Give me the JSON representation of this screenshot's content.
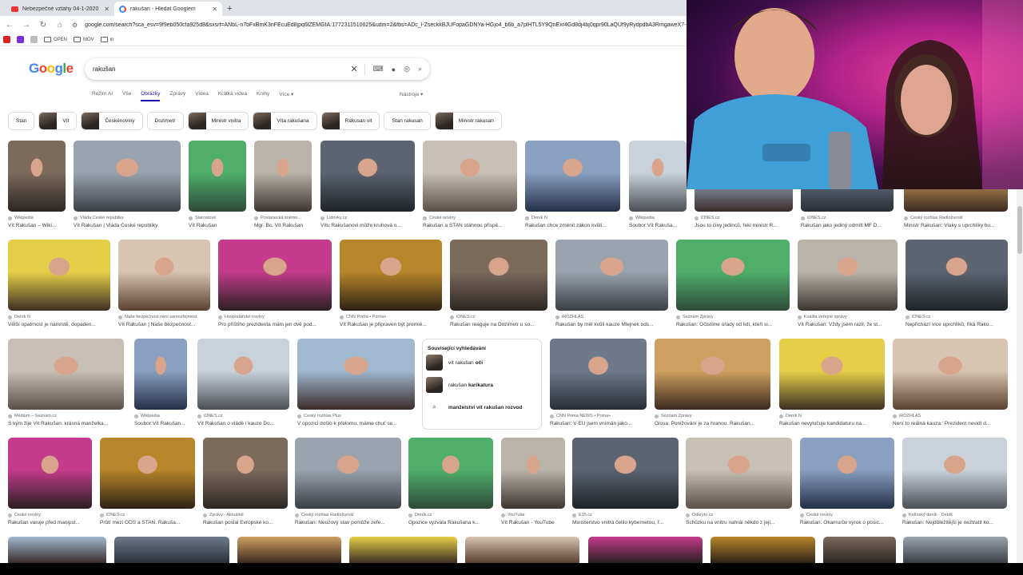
{
  "browser": {
    "tabs": [
      {
        "title": "Nebezpečné vztahy 04-1-2020",
        "active": false,
        "favicon": "youtube-icon"
      },
      {
        "title": "rakušan - Hledat Googlem",
        "active": true,
        "favicon": "google-icon"
      }
    ],
    "url": "google.com/search?sca_esv=9f9eb050cfa925d8&sxsrf=ANbL-n7bFxBmK3nFEcuEd8jpq6lZEMGfA:1772311510025&udm=2&fbs=ADc_l-ZseckkBJUFopaGDNYa-HGjo4_b6b_a7plHTL5Y9QnExr4Gd8dj4bj0qpr90LaQUf9yRydpdbA3RmgaweX7-8uxjZSty",
    "bookmarks": [
      "OPEN",
      "MOV",
      "in"
    ]
  },
  "search": {
    "query": "rakušan",
    "tabs": [
      "Režim AI",
      "Vše",
      "Obrázky",
      "Zprávy",
      "Videa",
      "Krátká videa",
      "Knihy",
      "Více ▾"
    ],
    "active_tab": "Obrázky",
    "tools": "Nástroje ▾"
  },
  "chips": [
    "Stan",
    "Vít",
    "Českénoviny",
    "Dozimetr",
    "Ministr vnitra",
    "Víta rakušana",
    "Rakusan vit",
    "Stan rakusan",
    "Ministr rakusan"
  ],
  "rows": [
    [
      {
        "src": "Wikipedia",
        "cap": "Vít Rakušan – Wiki..."
      },
      {
        "src": "Vláda České republiky",
        "cap": "Vít Rakušan | Vláda České republiky"
      },
      {
        "src": "Starostové",
        "cap": "Vít Rakušan"
      },
      {
        "src": "Poslanecká sněmo...",
        "cap": "Mgr. Bc. Vít Rakušan"
      },
      {
        "src": "Lidovky.cz",
        "cap": "Vítu Rakušanovi může kruhová o..."
      },
      {
        "src": "České noviny",
        "cap": "Rakušan a STAN stáhnou přispě..."
      },
      {
        "src": "Deník N",
        "cap": "Rakušan chce změnit zákon kvůli..."
      },
      {
        "src": "Wikipedia",
        "cap": "Soubor:Vít Rakuša..."
      },
      {
        "src": "iDNES.cz",
        "cap": "Jsou to činy jedinců, řekl ministr R..."
      },
      {
        "src": "iDNES.cz",
        "cap": "Rakušan jako jediný odmítl MF D..."
      },
      {
        "src": "Český rozhlas Radiožurnál",
        "cap": "Ministr Rakušan: Vlaky s uprchlíky bu..."
      }
    ],
    [
      {
        "src": "Deník N",
        "cap": "Větší opatrnost je namístě, dopaden..."
      },
      {
        "src": "Naše bezpečnost není samozřejmost",
        "cap": "Vít Rakušan | Naše bezpečnost..."
      },
      {
        "src": "Hospodářské noviny",
        "cap": "Pro příštího prezidenta mám jen dvě pod..."
      },
      {
        "src": "CNN Prima • Prima+",
        "cap": "Vít Rakušan je připraven být premié..."
      },
      {
        "src": "iDNES.cz",
        "cap": "Rakušan reaguje na Dozimetr u so..."
      },
      {
        "src": "iROZHLAS",
        "cap": "Rakušan by měl kvůli kauze Mlejnek ods..."
      },
      {
        "src": "Seznam Zprávy",
        "cap": "Rakušan: Očistíme úřady od lidí, kteří si..."
      },
      {
        "src": "Kvalita veřejné správy",
        "cap": "Vít Rakušan: Vždy jsem razil, že st..."
      },
      {
        "src": "iDNES.cz",
        "cap": "Nepřichází více uprchlíků, říká Raku..."
      }
    ],
    [
      {
        "src": "Médium – Seznam.cz",
        "cap": "S kým žije Vít Rakušan: krásná manželka..."
      },
      {
        "src": "Wikipedia",
        "cap": "Soubor:Vít Rakušan..."
      },
      {
        "src": "iDNES.cz",
        "cap": "Vít Rakušan o vládě i kauze Do..."
      },
      {
        "src": "Český rozhlas Plus",
        "cap": "V opozici došlo k přelomu, máme chuť se..."
      },
      {
        "src": "CNN Prima NEWS • Prima+",
        "cap": "Rakušan: V EU jsem vnímán jako..."
      },
      {
        "src": "Seznam Zprávy",
        "cap": "Glosa: Ponižování je za hranou. Rakušan..."
      },
      {
        "src": "Deník N",
        "cap": "Rakušan nevylučuje kandidaturu na..."
      },
      {
        "src": "iROZHLAS",
        "cap": "Není to reálná kauza.' Prezident nevidí d..."
      }
    ],
    [
      {
        "src": "České noviny",
        "cap": "Rakušan varuje před manipul..."
      },
      {
        "src": "iDNES.cz",
        "cap": "Průtí mezi ODS a STAN. Rakuša..."
      },
      {
        "src": "Zprávy - Aktuálně",
        "cap": "Rakušan poslal Evropské ko..."
      },
      {
        "src": "Český rozhlas Radiožurnál",
        "cap": "Rakušan: Neuzový stav pomůže zefe..."
      },
      {
        "src": "Deník.cz",
        "cap": "Opozice vyzvala Rakušana k..."
      },
      {
        "src": "YouTube",
        "cap": "Vít Rakušan - YouTube"
      },
      {
        "src": "E15.cz",
        "cap": "Ministerstvo vnitra čelilo kybernetou, ř..."
      },
      {
        "src": "Odkryto.cz",
        "cap": "Schůzku na vnitru nahrál někdo z její..."
      },
      {
        "src": "České noviny",
        "cap": "Rakušan: Okamurův výrok o posic..."
      },
      {
        "src": "Kolínský deník - Deník",
        "cap": "Rakušan: Nejdůležitější je neztratit ko..."
      }
    ]
  ],
  "related": {
    "title": "Související vyhledávání",
    "items": [
      {
        "pre": "vít rakušan ",
        "bold": "oči"
      },
      {
        "pre": "rakušan ",
        "bold": "karikatura"
      },
      {
        "pre": "manželství vít rakušan ",
        "bold": "rozvod"
      }
    ]
  },
  "colors": {
    "accent": "#1a0dab",
    "webcam_glow": "#e9409a"
  }
}
